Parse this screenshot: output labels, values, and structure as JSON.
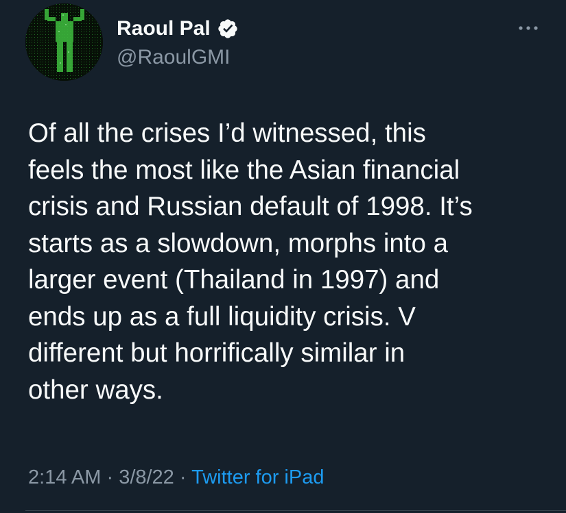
{
  "author": {
    "name": "Raoul Pal",
    "handle": "@RaoulGMI",
    "verified": true,
    "avatar_icon": "avatar-image"
  },
  "more_icon": "more-horizontal-icon",
  "tweet": {
    "lines": [
      "Of all the crises I’d witnessed, this",
      "feels the most like the Asian financial",
      "crisis and Russian default of 1998. It’s",
      "starts as a slowdown, morphs into a",
      "larger event (Thailand in 1997) and",
      "ends up as a full liquidity crisis. V",
      "different but horrifically similar in",
      "other ways."
    ]
  },
  "meta": {
    "time": "2:14 AM",
    "separator": " · ",
    "date": "3/8/22",
    "source": "Twitter for iPad"
  },
  "colors": {
    "background": "#15202b",
    "text": "#f7f9f9",
    "secondary": "#8b98a5",
    "link": "#1d9bf0"
  }
}
